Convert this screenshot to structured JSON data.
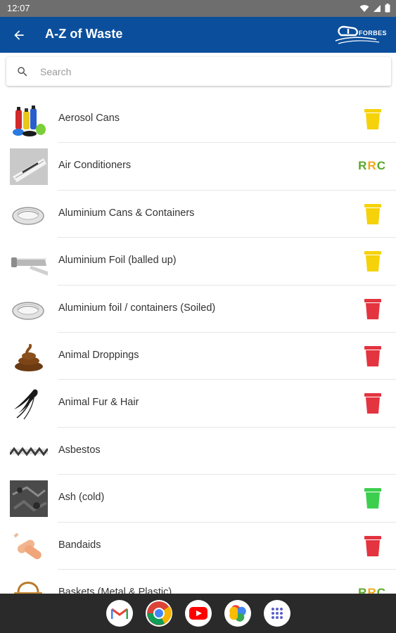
{
  "status": {
    "time": "12:07"
  },
  "app_bar": {
    "title": "A-Z of Waste",
    "logo_text": "FORBES"
  },
  "search": {
    "placeholder": "Search",
    "value": ""
  },
  "colors": {
    "app_bar": "#0b4f9c",
    "bin_yellow": "#f5d20a",
    "bin_red": "#e3343f",
    "bin_green": "#3ccf4e",
    "rrc_green": "#5aa82a",
    "rrc_orange": "#f0a81c"
  },
  "items": [
    {
      "label": "Aerosol Cans",
      "icon": "aerosol-cans",
      "bin": "yellow"
    },
    {
      "label": "Air Conditioners",
      "icon": "air-conditioner",
      "bin": "rrc",
      "bin_text": "RRC"
    },
    {
      "label": "Aluminium Cans & Containers",
      "icon": "aluminium-container",
      "bin": "yellow"
    },
    {
      "label": "Aluminium Foil (balled up)",
      "icon": "aluminium-foil",
      "bin": "yellow"
    },
    {
      "label": "Aluminium foil / containers (Soiled)",
      "icon": "aluminium-container",
      "bin": "red"
    },
    {
      "label": "Animal Droppings",
      "icon": "animal-droppings",
      "bin": "red"
    },
    {
      "label": "Animal Fur & Hair",
      "icon": "animal-fur",
      "bin": "red"
    },
    {
      "label": "Asbestos",
      "icon": "asbestos",
      "bin": "none"
    },
    {
      "label": "Ash (cold)",
      "icon": "ash",
      "bin": "green"
    },
    {
      "label": "Bandaids",
      "icon": "bandaids",
      "bin": "red"
    },
    {
      "label": "Baskets (Metal & Plastic)",
      "icon": "basket",
      "bin": "rrc",
      "bin_text": "RRC"
    }
  ],
  "dock": [
    "gmail",
    "chrome",
    "youtube",
    "photos",
    "app-drawer"
  ]
}
